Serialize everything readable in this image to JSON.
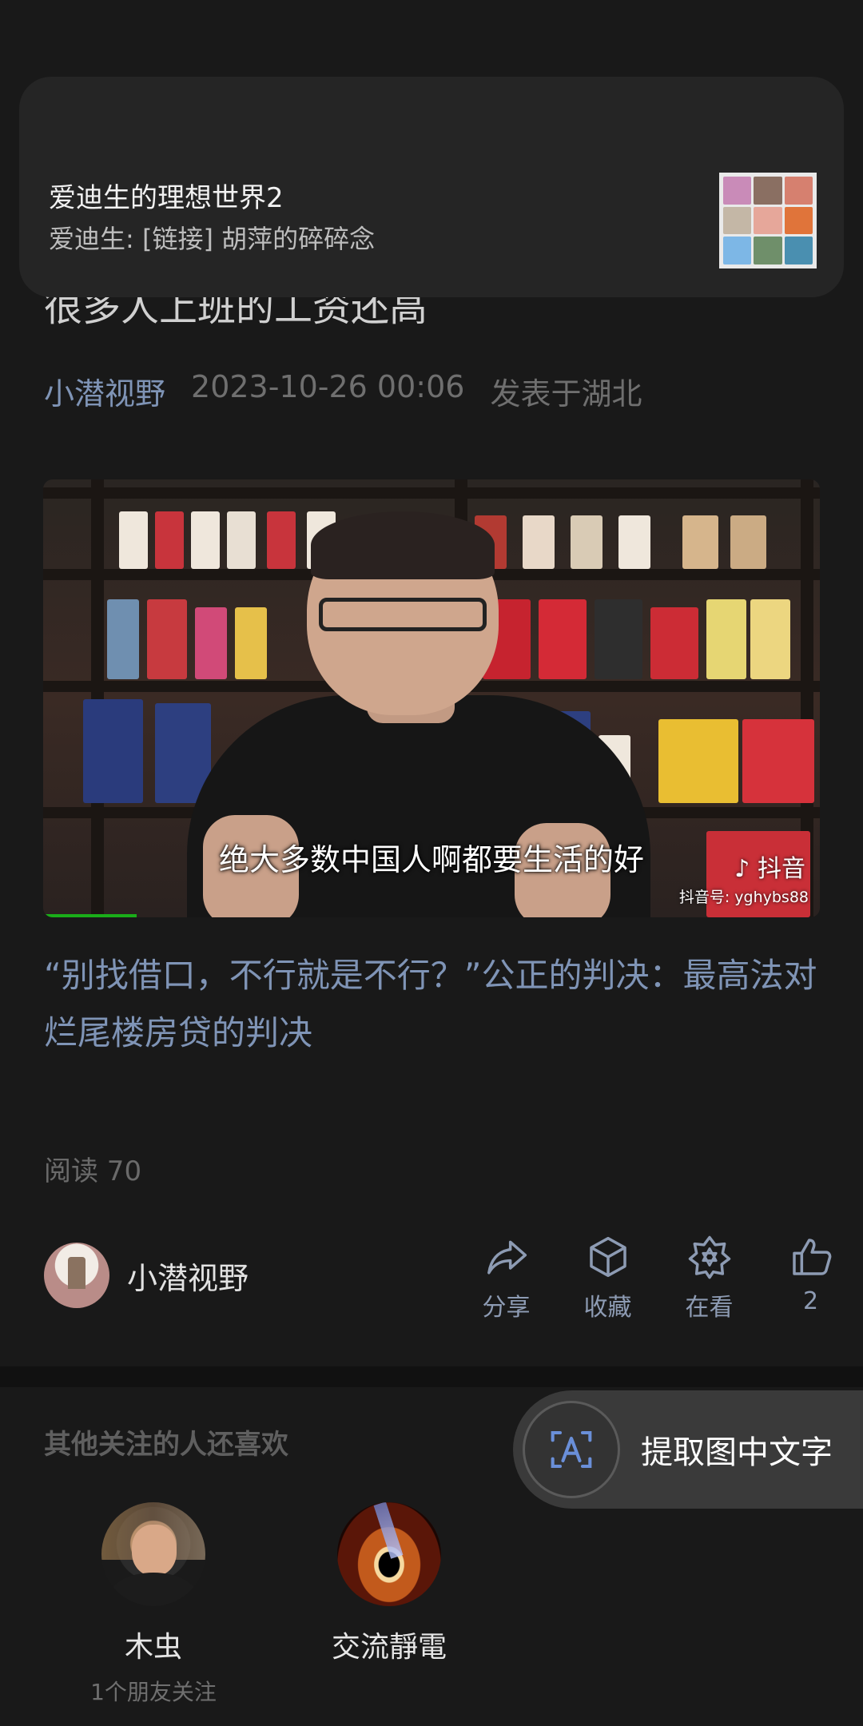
{
  "notification": {
    "title": "爱迪生的理想世界2",
    "message": "爱迪生: [链接] 胡萍的碎碎念"
  },
  "article": {
    "title_partial": "很多人上班的工资还高",
    "author": "小潜视野",
    "date": "2023-10-26 00:06",
    "location": "发表于湖北",
    "video": {
      "subtitle": "绝大多数中国人啊都要生活的好",
      "watermark_logo": "抖音",
      "watermark_id": "抖音号: yghybs88",
      "progress": 0.12
    },
    "link_title": "“别找借口，不行就是不行？”公正的判决：最高法对烂尾楼房贷的判决",
    "reads": "阅读 70"
  },
  "footer": {
    "author_name": "小潜视野",
    "actions": [
      {
        "icon": "share-icon",
        "label": "分享"
      },
      {
        "icon": "favorite-icon",
        "label": "收藏"
      },
      {
        "icon": "wow-icon",
        "label": "在看"
      },
      {
        "icon": "like-icon",
        "label": "2"
      }
    ]
  },
  "recommendations": {
    "heading": "其他关注的人还喜欢",
    "items": [
      {
        "name": "木虫",
        "sub": "1个朋友关注"
      },
      {
        "name": "交流靜電",
        "sub": ""
      }
    ]
  },
  "ocr_button": {
    "label": "提取图中文字",
    "icon": "text-recognition-icon"
  },
  "colors": {
    "background": "#191919",
    "link": "#7f94b6",
    "action_label": "#8d9bb3"
  }
}
